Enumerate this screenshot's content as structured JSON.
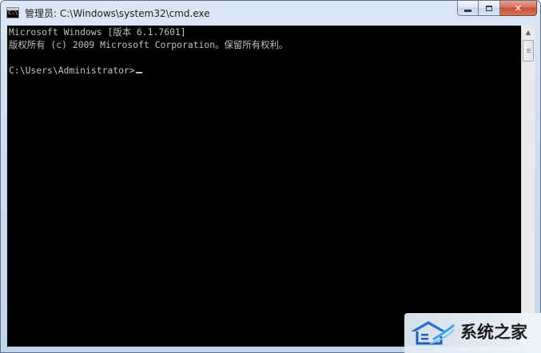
{
  "window": {
    "title": "管理员: C:\\Windows\\system32\\cmd.exe",
    "icon_label": "C:\\"
  },
  "caption_buttons": {
    "minimize": "minimize-icon",
    "maximize": "maximize-icon",
    "close_glyph": "✕"
  },
  "console": {
    "lines": [
      "Microsoft Windows [版本 6.1.7601]",
      "版权所有 (c) 2009 Microsoft Corporation。保留所有权利。",
      "",
      "C:\\Users\\Administrator>"
    ],
    "text_color": "#c0c0c0",
    "background_color": "#000000"
  },
  "scrollbar": {
    "up_arrow": "▲",
    "down_arrow": "▼"
  },
  "watermark": {
    "text": "系统之家",
    "logo": "house-logo-icon"
  }
}
